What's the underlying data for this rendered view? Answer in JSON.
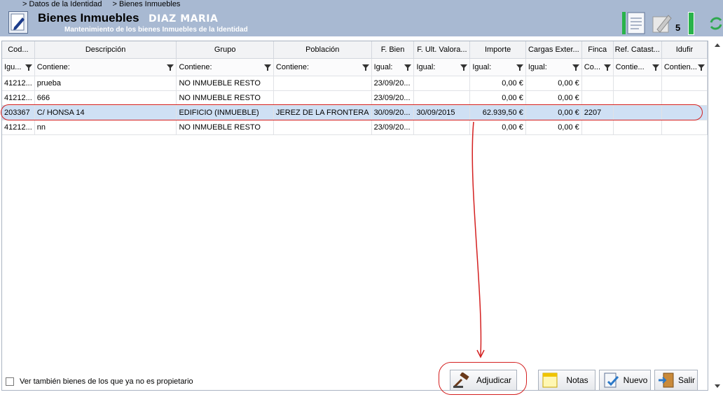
{
  "breadcrumb": [
    "> Datos de la Identidad",
    "> Bienes Inmuebles"
  ],
  "header": {
    "title": "Bienes Inmuebles",
    "identity": "DIAZ MARIA",
    "subtitle": "Mantenimiento de los bienes Inmuebles de la Identidad",
    "count": "5"
  },
  "columns": [
    {
      "label": "Cod...",
      "filter": "Igu..."
    },
    {
      "label": "Descripción",
      "filter": "Contiene:"
    },
    {
      "label": "Grupo",
      "filter": "Contiene:"
    },
    {
      "label": "Población",
      "filter": "Contiene:"
    },
    {
      "label": "F. Bien",
      "filter": "Igual:"
    },
    {
      "label": "F. Ult. Valora...",
      "filter": "Igual:"
    },
    {
      "label": "Importe",
      "filter": "Igual:"
    },
    {
      "label": "Cargas Exter...",
      "filter": "Igual:"
    },
    {
      "label": "Finca",
      "filter": "Co..."
    },
    {
      "label": "Ref. Catast...",
      "filter": "Contie..."
    },
    {
      "label": "Idufir",
      "filter": "Contien..."
    }
  ],
  "rows": [
    {
      "cells": [
        "41212...",
        "prueba",
        "NO INMUEBLE RESTO",
        "",
        "23/09/20...",
        "",
        "0,00 €",
        "0,00 €",
        "",
        "",
        ""
      ],
      "selected": false
    },
    {
      "cells": [
        "41212...",
        "666",
        "NO INMUEBLE RESTO",
        "",
        "23/09/20...",
        "",
        "0,00 €",
        "0,00 €",
        "",
        "",
        ""
      ],
      "selected": false
    },
    {
      "cells": [
        "203367",
        "C/ HONSA 14",
        "EDIFICIO (INMUEBLE)",
        "JEREZ DE LA FRONTERA",
        "30/09/20...",
        "30/09/2015",
        "62.939,50 €",
        "0,00 €",
        "2207",
        "",
        ""
      ],
      "selected": true
    },
    {
      "cells": [
        "41212...",
        "nn",
        "NO INMUEBLE RESTO",
        "",
        "23/09/20...",
        "",
        "0,00 €",
        "0,00 €",
        "",
        "",
        ""
      ],
      "selected": false
    }
  ],
  "footer": {
    "checkbox_label": "Ver también bienes de los que ya no es propietario",
    "checked": false
  },
  "buttons": {
    "adjudicar": "Adjudicar",
    "notas": "Notas",
    "nuevo": "Nuevo",
    "salir": "Salir"
  },
  "colors": {
    "header_bg": "#a8b9d2",
    "selection": "#cfe0f4",
    "annotation": "#d42020"
  }
}
